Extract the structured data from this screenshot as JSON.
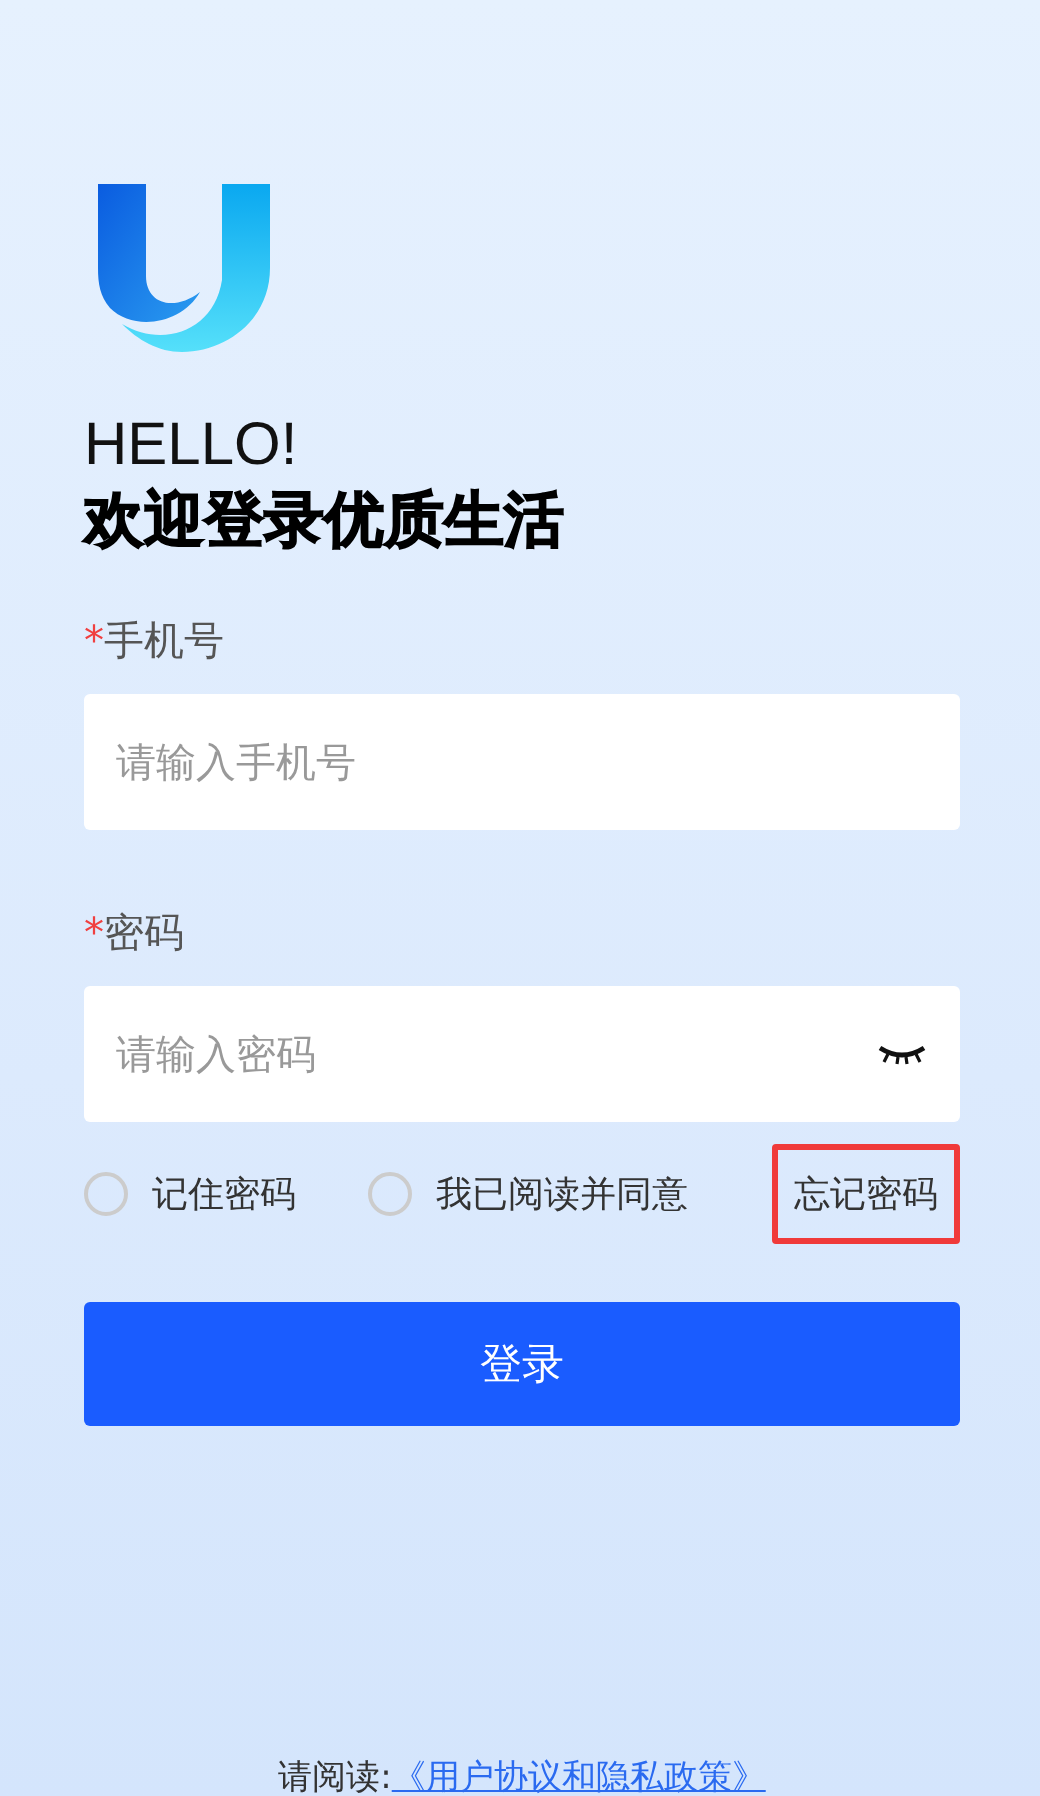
{
  "greeting": "HELLO!",
  "headline": "欢迎登录优质生活",
  "fields": [
    {
      "label": "手机号",
      "required_mark": "*",
      "placeholder": "请输入手机号",
      "kind": "text"
    },
    {
      "label": "密码",
      "required_mark": "*",
      "placeholder": "请输入密码",
      "kind": "password"
    }
  ],
  "options": [
    {
      "label": "记住密码",
      "checked": false
    },
    {
      "label": "我已阅读并同意",
      "checked": false
    }
  ],
  "forgot_link": {
    "label": "忘记密码",
    "highlighted": true
  },
  "login_button": "登录",
  "footer": {
    "prompt": "请阅读:",
    "link": "《用户协议和隐私政策》"
  }
}
